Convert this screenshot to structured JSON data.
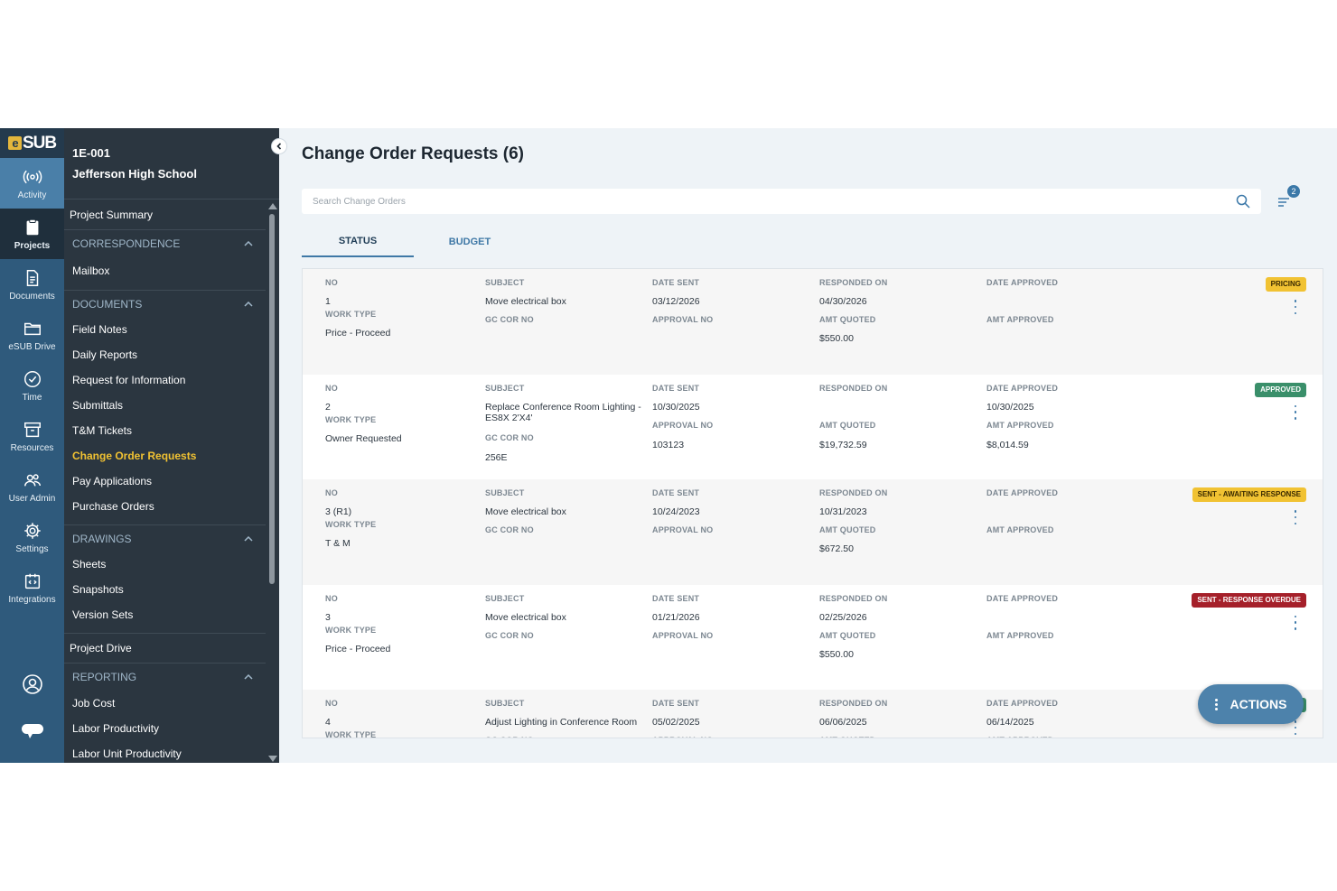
{
  "brand": {
    "logo_text": "SUB",
    "logo_e": "e"
  },
  "rail": {
    "items": [
      {
        "label": "Activity",
        "icon": "activity-icon"
      },
      {
        "label": "Projects",
        "icon": "clipboard-icon"
      },
      {
        "label": "Documents",
        "icon": "document-icon"
      },
      {
        "label": "eSUB Drive",
        "icon": "folder-icon"
      },
      {
        "label": "Time",
        "icon": "clock-icon"
      },
      {
        "label": "Resources",
        "icon": "box-icon"
      },
      {
        "label": "User Admin",
        "icon": "users-icon"
      },
      {
        "label": "Settings",
        "icon": "gear-icon"
      },
      {
        "label": "Integrations",
        "icon": "integration-icon"
      }
    ]
  },
  "project": {
    "code": "1E-001",
    "name": "Jefferson High School"
  },
  "nav": {
    "project_summary": "Project Summary",
    "correspondence": {
      "title": "CORRESPONDENCE",
      "items": [
        "Mailbox"
      ]
    },
    "documents": {
      "title": "DOCUMENTS",
      "items": [
        "Field Notes",
        "Daily Reports",
        "Request for Information",
        "Submittals",
        "T&M Tickets",
        "Change Order Requests",
        "Pay Applications",
        "Purchase Orders"
      ]
    },
    "drawings": {
      "title": "DRAWINGS",
      "items": [
        "Sheets",
        "Snapshots",
        "Version Sets"
      ]
    },
    "project_drive": "Project Drive",
    "reporting": {
      "title": "REPORTING",
      "items": [
        "Job Cost",
        "Labor Productivity",
        "Labor Unit Productivity"
      ]
    }
  },
  "main": {
    "title": "Change Order Requests (6)",
    "search_placeholder": "Search Change Orders",
    "filter_count": "2",
    "tabs": [
      "STATUS",
      "BUDGET"
    ],
    "actions_label": "ACTIONS"
  },
  "labels": {
    "no": "NO",
    "work_type": "WORK TYPE",
    "subject": "SUBJECT",
    "gc_cor_no": "GC COR NO",
    "date_sent": "DATE SENT",
    "approval_no": "APPROVAL NO",
    "responded_on": "RESPONDED ON",
    "amt_quoted": "AMT QUOTED",
    "date_approved": "DATE APPROVED",
    "amt_approved": "AMT APPROVED"
  },
  "colors": {
    "pricing": "#f1c232",
    "approved": "#3a8f6a",
    "awaiting": "#f1c232",
    "overdue": "#a5202a"
  },
  "rows": [
    {
      "no": "1",
      "work_type": "Price - Proceed",
      "subject": "Move electrical box",
      "gc_cor_no": "",
      "date_sent": "03/12/2026",
      "approval_no": "",
      "responded_on": "04/30/2026",
      "amt_quoted": "$550.00",
      "date_approved": "",
      "amt_approved": "",
      "status": "PRICING",
      "status_kind": "pricing"
    },
    {
      "no": "2",
      "work_type": "Owner Requested",
      "subject": "Replace Conference Room Lighting - ES8X 2'X4'",
      "gc_cor_no": "256E",
      "date_sent": "10/30/2025",
      "approval_no": "103123",
      "responded_on": "",
      "amt_quoted": "$19,732.59",
      "date_approved": "10/30/2025",
      "amt_approved": "$8,014.59",
      "status": "APPROVED",
      "status_kind": "approved"
    },
    {
      "no": "3 (R1)",
      "work_type": "T & M",
      "subject": "Move electrical box",
      "gc_cor_no": "",
      "date_sent": "10/24/2023",
      "approval_no": "",
      "responded_on": "10/31/2023",
      "amt_quoted": "$672.50",
      "date_approved": "",
      "amt_approved": "",
      "status": "SENT - AWAITING RESPONSE",
      "status_kind": "awaiting"
    },
    {
      "no": "3",
      "work_type": "Price - Proceed",
      "subject": "Move electrical box",
      "gc_cor_no": "",
      "date_sent": "01/21/2026",
      "approval_no": "",
      "responded_on": "02/25/2026",
      "amt_quoted": "$550.00",
      "date_approved": "",
      "amt_approved": "",
      "status": "SENT - RESPONSE OVERDUE",
      "status_kind": "overdue"
    },
    {
      "no": "4",
      "work_type": "",
      "subject": "Adjust Lighting in Conference Room",
      "gc_cor_no": "",
      "date_sent": "05/02/2025",
      "approval_no": "",
      "responded_on": "06/06/2025",
      "amt_quoted": "",
      "date_approved": "06/14/2025",
      "amt_approved": "",
      "status": "",
      "status_kind": "approved"
    }
  ]
}
